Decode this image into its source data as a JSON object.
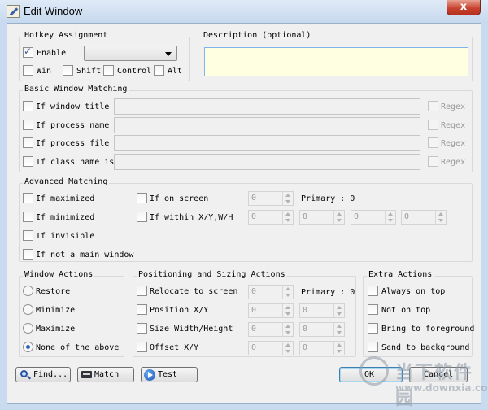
{
  "window": {
    "title": "Edit Window",
    "close_glyph": "x"
  },
  "hotkey": {
    "legend": "Hotkey Assignment",
    "enable_label": "Enable",
    "enable_checked": true,
    "win_label": "Win",
    "shift_label": "Shift",
    "control_label": "Control",
    "alt_label": "Alt"
  },
  "description": {
    "legend": "Description (optional)",
    "value": ""
  },
  "basic": {
    "legend": "Basic Window Matching",
    "rows": [
      {
        "label": "If window title is",
        "regex": "Regex"
      },
      {
        "label": "If process name is",
        "regex": "Regex"
      },
      {
        "label": "If process file is",
        "regex": "Regex"
      },
      {
        "label": "If class name is",
        "regex": "Regex"
      }
    ]
  },
  "advanced": {
    "legend": "Advanced Matching",
    "maximized": "If maximized",
    "minimized": "If minimized",
    "invisible": "If invisible",
    "not_main": "If not a main window",
    "on_screen": "If on screen",
    "within": "If within X/Y,W/H",
    "on_screen_value": "0",
    "primary_label": "Primary : 0",
    "within_values": [
      "0",
      "0",
      "0",
      "0"
    ]
  },
  "window_actions": {
    "legend": "Window Actions",
    "options": [
      "Restore",
      "Minimize",
      "Maximize",
      "None of the above"
    ],
    "selected": "None of the above"
  },
  "positioning": {
    "legend": "Positioning and Sizing Actions",
    "relocate": "Relocate to screen",
    "relocate_value": "0",
    "primary_label": "Primary : 0",
    "position": "Position X/Y",
    "size": "Size Width/Height",
    "offset": "Offset X/Y",
    "pair_values": [
      "0",
      "0"
    ]
  },
  "extra": {
    "legend": "Extra Actions",
    "always_on_top": "Always on top",
    "not_on_top": "Not on top",
    "bring_to_foreground": "Bring to foreground",
    "send_to_background": "Send to background"
  },
  "buttons": {
    "find": "Find...",
    "match": "Match",
    "test": "Test",
    "ok": "OK",
    "cancel": "Cancel"
  },
  "watermark": {
    "cn": "当下软件园",
    "url": "www.downxia.com"
  },
  "colors": {
    "description_bg": "#ffffe1",
    "close_button": "#c74430",
    "titlebar": "#c9dcef"
  }
}
